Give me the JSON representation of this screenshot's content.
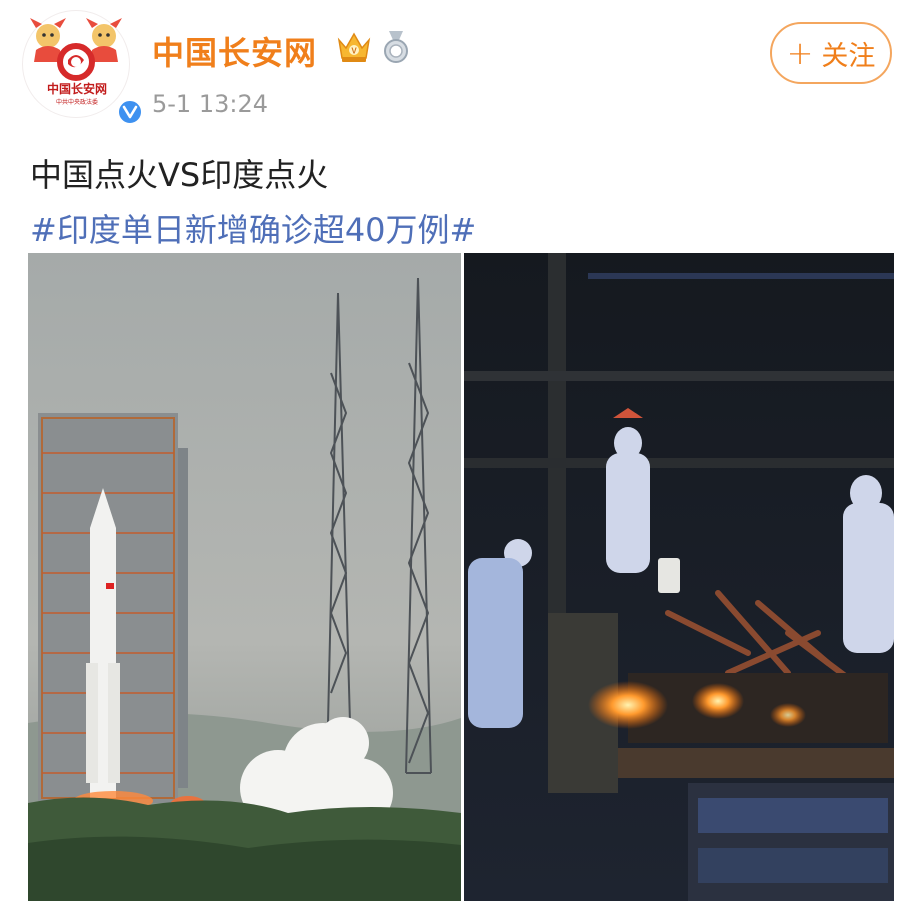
{
  "account": {
    "name": "中国长安网",
    "avatar_caption": "中国长安网",
    "avatar_subcaption": "中共中央政法委",
    "time": "5-1 13:24"
  },
  "follow_button": {
    "label": "关注"
  },
  "post": {
    "text": "中国点火VS印度点火",
    "hashtag": "#印度单日新增确诊超40万例#"
  },
  "icons": [
    "avatar-logo-icon",
    "verified-icon",
    "crown-badge-icon",
    "medal-badge-icon",
    "plus-icon"
  ],
  "colors": {
    "brand_orange": "#f07f1b",
    "hashtag_blue": "#4f6fb8",
    "verified_blue": "#3e91f0",
    "time_gray": "#9a9a9a"
  }
}
